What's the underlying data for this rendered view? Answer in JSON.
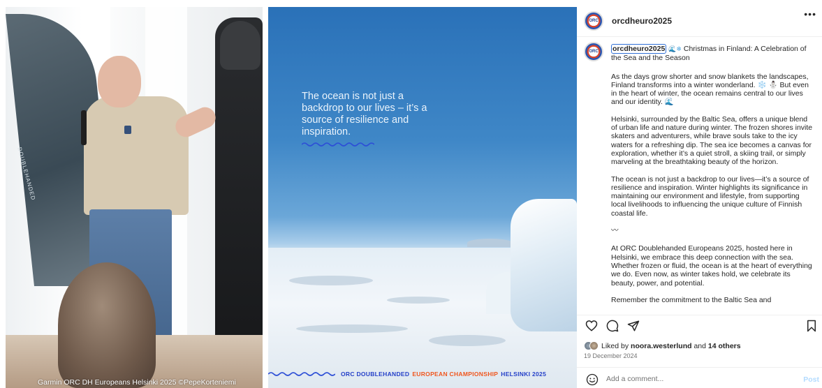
{
  "left_photo": {
    "banner_text": "DOUBLEHANDED",
    "credit": "Garmin ORC DH Europeans Helsinki 2025 ©PepeKorteniemi"
  },
  "middle_photo": {
    "quote": "The ocean is not just a backdrop to our lives – it’s a source of resilience and inspiration.",
    "strip": {
      "part1": "ORC DOUBLEHANDED",
      "part2": "EUROPEAN CHAMPIONSHIP",
      "part3": "HELSINKI 2025"
    }
  },
  "post": {
    "username": "orcdheuro2025",
    "avatar_text": "ORC",
    "more_icon": "•••",
    "caption": {
      "user": "orcdheuro2025",
      "title_emoji": "🌊❄",
      "title": "Christmas in Finland: A Celebration of the Sea and the Season",
      "paragraphs": [
        "As the days grow shorter and snow blankets the landscapes, Finland transforms into a winter wonderland. ❄️ ⛄ But even in the heart of winter, the ocean remains central to our lives and our identity. 🌊",
        "Helsinki, surrounded by the Baltic Sea, offers a unique blend of urban life and nature during winter. The frozen shores invite skaters and adventurers, while brave souls take to the icy waters for a refreshing dip. The sea ice becomes a canvas for exploration, whether it’s a quiet stroll, a skiing trail, or simply marveling at the breathtaking beauty of the horizon.",
        "The ocean is not just a backdrop to our lives—it’s a source of resilience and inspiration. Winter highlights its significance in maintaining our environment and lifestyle, from supporting local livelihoods to influencing the unique culture of Finnish coastal life.",
        "〰",
        "At ORC Doublehanded Europeans 2025, hosted here in Helsinki, we embrace this deep connection with the sea. Whether frozen or fluid, the ocean is at the heart of everything we do. Even now, as winter takes hold, we celebrate its beauty, power, and potential.",
        "Remember the commitment to the Baltic Sea and"
      ]
    },
    "likes": {
      "prefix": "Liked by",
      "user": "noora.westerlund",
      "middle": "and",
      "others": "14 others"
    },
    "date": "19 December 2024",
    "comment_placeholder": "Add a comment...",
    "post_button": "Post"
  },
  "colors": {
    "instagram_link_blue": "#b3dbff",
    "strip_blue": "#2440c8",
    "strip_orange": "#f0561d"
  }
}
